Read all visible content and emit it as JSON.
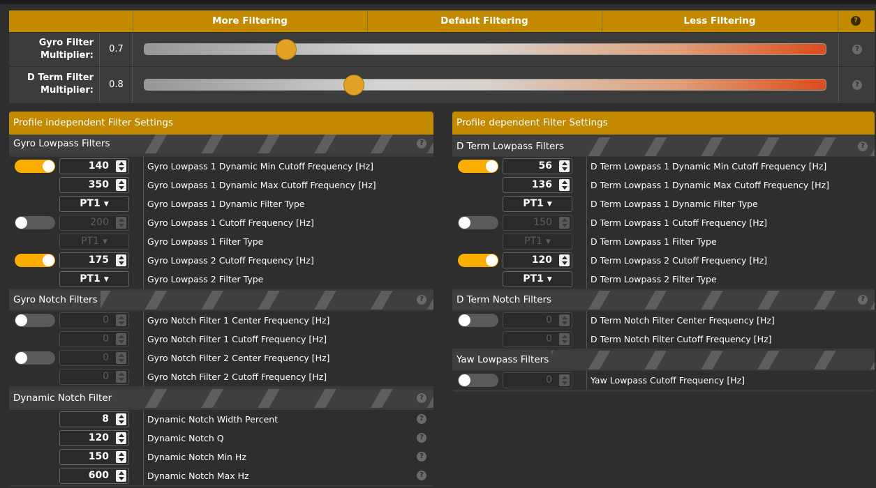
{
  "header": {
    "more": "More Filtering",
    "default": "Default Filtering",
    "less": "Less Filtering"
  },
  "sliders": [
    {
      "label": "Gyro Filter Multiplier:",
      "value": "0.7",
      "position": 0.2
    },
    {
      "label": "D Term Filter Multiplier:",
      "value": "0.8",
      "position": 0.3
    }
  ],
  "left": {
    "title": "Profile independent Filter Settings",
    "sections": {
      "gyro_lowpass": "Gyro Lowpass Filters",
      "gyro_notch": "Gyro Notch Filters",
      "dynamic_notch": "Dynamic Notch Filter"
    },
    "rows": [
      {
        "value": "140",
        "label": "Gyro Lowpass 1 Dynamic Min Cutoff Frequency [Hz]"
      },
      {
        "value": "350",
        "label": "Gyro Lowpass 1 Dynamic Max Cutoff Frequency [Hz]"
      },
      {
        "value": "PT1",
        "label": "Gyro Lowpass 1 Dynamic Filter Type"
      },
      {
        "value": "200",
        "label": "Gyro Lowpass 1 Cutoff Frequency [Hz]"
      },
      {
        "value": "PT1",
        "label": "Gyro Lowpass 1 Filter Type"
      },
      {
        "value": "175",
        "label": "Gyro Lowpass 2 Cutoff Frequency [Hz]"
      },
      {
        "value": "PT1",
        "label": "Gyro Lowpass 2 Filter Type"
      },
      {
        "value": "0",
        "label": "Gyro Notch Filter 1 Center Frequency [Hz]"
      },
      {
        "value": "0",
        "label": "Gyro Notch Filter 1 Cutoff Frequency [Hz]"
      },
      {
        "value": "0",
        "label": "Gyro Notch Filter 2 Center Frequency [Hz]"
      },
      {
        "value": "0",
        "label": "Gyro Notch Filter 2 Cutoff Frequency [Hz]"
      },
      {
        "value": "8",
        "label": "Dynamic Notch Width Percent"
      },
      {
        "value": "120",
        "label": "Dynamic Notch Q"
      },
      {
        "value": "150",
        "label": "Dynamic Notch Min Hz"
      },
      {
        "value": "600",
        "label": "Dynamic Notch Max Hz"
      }
    ]
  },
  "right": {
    "title": "Profile dependent Filter Settings",
    "sections": {
      "dterm_lowpass": "D Term Lowpass Filters",
      "dterm_notch": "D Term Notch Filters",
      "yaw_lowpass": "Yaw Lowpass Filters"
    },
    "rows": [
      {
        "value": "56",
        "label": "D Term Lowpass 1 Dynamic Min Cutoff Frequency [Hz]"
      },
      {
        "value": "136",
        "label": "D Term Lowpass 1 Dynamic Max Cutoff Frequency [Hz]"
      },
      {
        "value": "PT1",
        "label": "D Term Lowpass 1 Dynamic Filter Type"
      },
      {
        "value": "150",
        "label": "D Term Lowpass 1 Cutoff Frequency [Hz]"
      },
      {
        "value": "PT1",
        "label": "D Term Lowpass 1 Filter Type"
      },
      {
        "value": "120",
        "label": "D Term Lowpass 2 Cutoff Frequency [Hz]"
      },
      {
        "value": "PT1",
        "label": "D Term Lowpass 2 Filter Type"
      },
      {
        "value": "0",
        "label": "D Term Notch Filter Center Frequency [Hz]"
      },
      {
        "value": "0",
        "label": "D Term Notch Filter Cutoff Frequency [Hz]"
      },
      {
        "value": "0",
        "label": "Yaw Lowpass Cutoff Frequency [Hz]"
      }
    ]
  },
  "toggles": {
    "gyro_lp1_dynamic": true,
    "gyro_lp1": false,
    "gyro_lp2": true,
    "gyro_notch1": false,
    "gyro_notch2": false,
    "dterm_lp1_dynamic": true,
    "dterm_lp1": false,
    "dterm_lp2": true,
    "dterm_notch": false,
    "yaw_lp": false
  },
  "icons": {
    "help": "question-circle-icon"
  },
  "colors": {
    "accent": "#c38a00",
    "toggle_on": "#fcae00",
    "slider_thumb": "#e2a225",
    "slider_end": "#dc4d1c"
  }
}
